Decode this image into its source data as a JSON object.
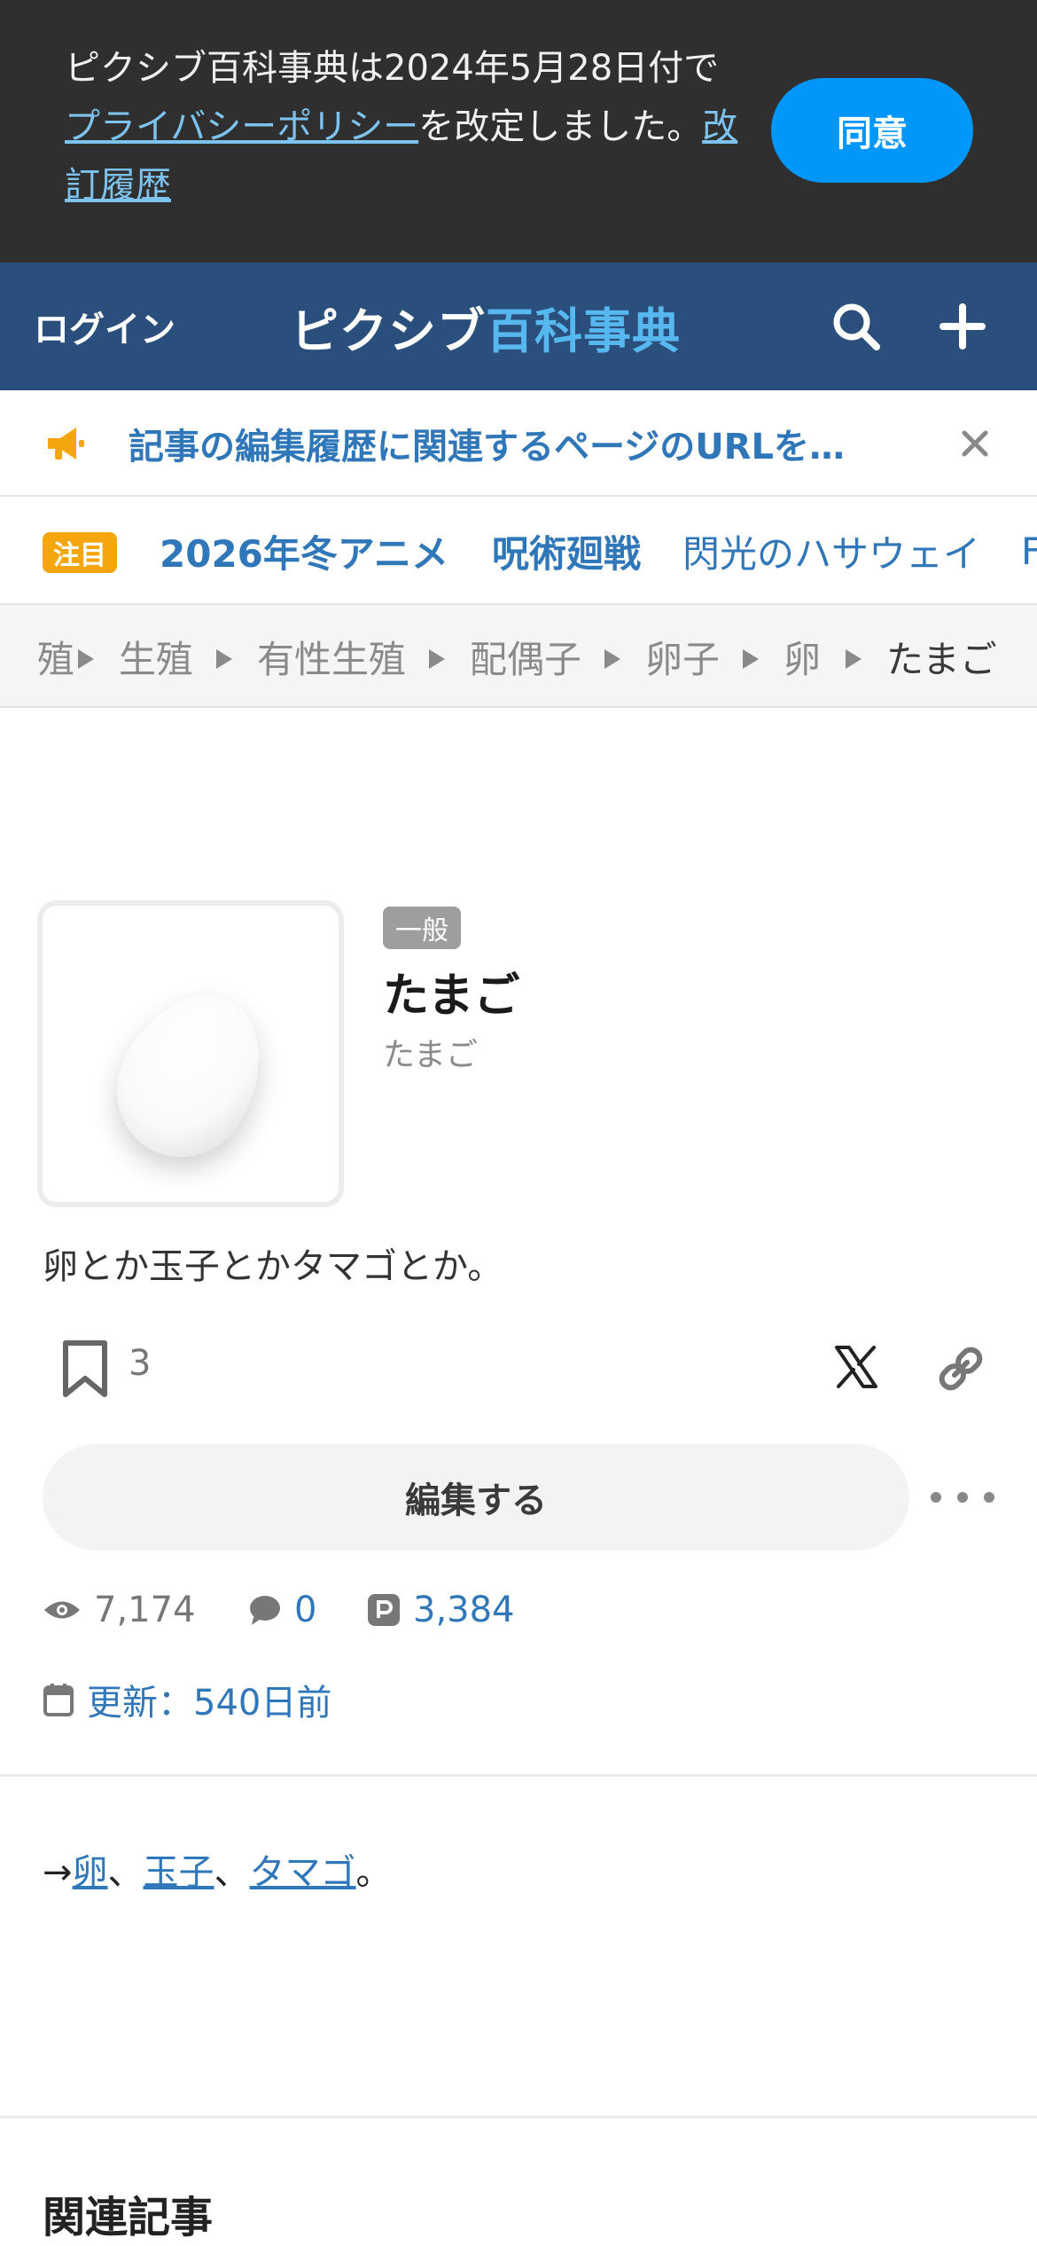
{
  "consent": {
    "text_before": "ピクシブ百科事典は2024年5月28日付で",
    "privacy_link": "プライバシーポリシー",
    "text_middle": "を改定しました。",
    "history_link": "改訂履歴",
    "agree_label": "同意"
  },
  "header": {
    "login_label": "ログイン",
    "logo_part1": "ピクシブ",
    "logo_part2": "百科事典",
    "search_icon": "search-icon",
    "add_icon": "plus-icon"
  },
  "notice": {
    "icon": "megaphone-icon",
    "text": "記事の編集履歴に関連するページのURLを…",
    "close_icon": "close-icon"
  },
  "trending": {
    "badge": "注目",
    "items": [
      "2026年冬アニメ",
      "呪術廻戦",
      "閃光のハサウェイ",
      "F"
    ]
  },
  "breadcrumb": {
    "items": [
      "生殖",
      "有性生殖",
      "配偶子",
      "卵子",
      "卵",
      "たまご"
    ],
    "partial_first": "殖"
  },
  "article": {
    "category": "一般",
    "title": "たまご",
    "reading": "たまご",
    "summary": "卵とか玉子とかタマゴとか。",
    "bookmark_count": "3",
    "edit_label": "編集する",
    "views": "7,174",
    "comments": "0",
    "pixiv_count": "3,384",
    "updated": "更新：540日前"
  },
  "body": {
    "arrow": "→",
    "links": [
      "卵",
      "玉子",
      "タマゴ"
    ],
    "sep": "、",
    "end": "。"
  },
  "related": {
    "heading": "関連記事"
  },
  "colors": {
    "header_bg": "#2b4f7c",
    "accent_blue": "#0096fa",
    "link_blue": "#2f77b8",
    "badge_orange": "#f5a60f"
  }
}
